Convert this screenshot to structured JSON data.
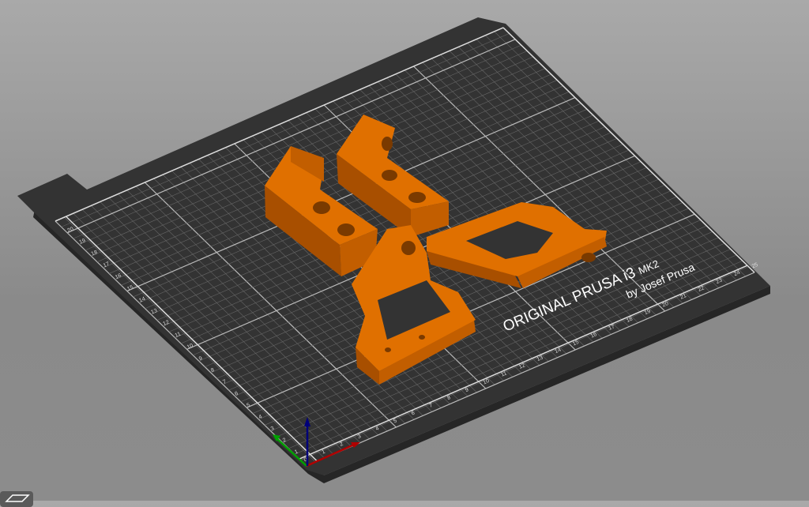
{
  "bed": {
    "logo_line1": "ORIGINAL PRUSA i3",
    "logo_model": "MK2",
    "logo_line2": "by Josef Prusa",
    "x_ticks": [
      "0",
      "1",
      "2",
      "3",
      "4",
      "5",
      "6",
      "7",
      "8",
      "9",
      "10",
      "11",
      "12",
      "13",
      "14",
      "15",
      "16",
      "17",
      "18",
      "19",
      "20",
      "21",
      "22",
      "23",
      "24",
      "25"
    ],
    "y_ticks": [
      "1",
      "2",
      "3",
      "4",
      "5",
      "6",
      "7",
      "8",
      "9",
      "10",
      "11",
      "12",
      "13",
      "14",
      "15",
      "16",
      "17",
      "18",
      "19",
      "20"
    ]
  },
  "colors": {
    "part": "#e07000",
    "part_dark": "#a84f00",
    "part_side": "#c25e00",
    "bed": "#2f2f2f",
    "grid": "#8a8a8a",
    "axis_x": "#b00000",
    "axis_y": "#00a000",
    "axis_z": "#00007a"
  },
  "toolbar": {
    "view_icon": "layers-view-icon"
  }
}
